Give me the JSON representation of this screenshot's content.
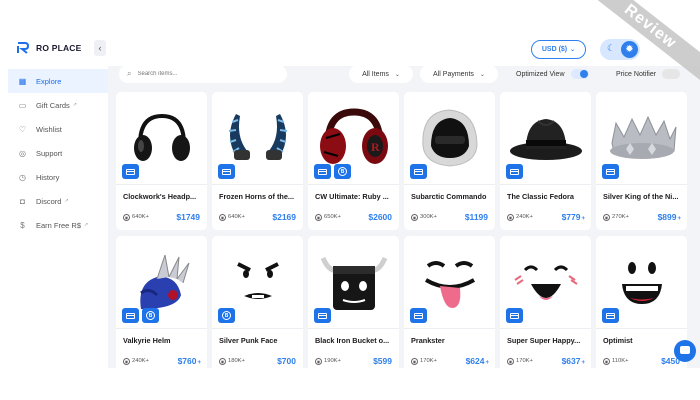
{
  "brand": {
    "name": "RO PLACE",
    "accent": "#2f80ed"
  },
  "sidebar": {
    "collapse_icon": "chevron-left-icon",
    "items": [
      {
        "label": "Explore",
        "icon": "grid-icon",
        "active": true,
        "external": false
      },
      {
        "label": "Gift Cards",
        "icon": "gift-card-icon",
        "active": false,
        "external": true
      },
      {
        "label": "Wishlist",
        "icon": "heart-icon",
        "active": false,
        "external": false
      },
      {
        "label": "Support",
        "icon": "support-icon",
        "active": false,
        "external": false
      },
      {
        "label": "History",
        "icon": "clock-icon",
        "active": false,
        "external": false
      },
      {
        "label": "Discord",
        "icon": "discord-icon",
        "active": false,
        "external": true
      },
      {
        "label": "Earn Free R$",
        "icon": "dollar-icon",
        "active": false,
        "external": true
      }
    ]
  },
  "topbar": {
    "currency": "USD ($)",
    "theme_moon_icon": "moon-icon",
    "theme_sun_icon": "sun-icon"
  },
  "filters": {
    "search_placeholder": "Search items...",
    "category": "All Items",
    "payments": "All Payments",
    "optimized_label": "Optimized View",
    "optimized_on": true,
    "notifier_label": "Price Notifier",
    "notifier_on": false
  },
  "ribbon": "Review",
  "items": [
    {
      "name": "Clockwork's Headp...",
      "sold": "640K+",
      "price": "$1749",
      "plus": "",
      "coin": false
    },
    {
      "name": "Frozen Horns of the...",
      "sold": "640K+",
      "price": "$2169",
      "plus": "",
      "coin": false
    },
    {
      "name": "CW Ultimate: Ruby ...",
      "sold": "650K+",
      "price": "$2600",
      "plus": "",
      "coin": true
    },
    {
      "name": "Subarctic Commando",
      "sold": "300K+",
      "price": "$1199",
      "plus": "",
      "coin": false
    },
    {
      "name": "The Classic Fedora",
      "sold": "240K+",
      "price": "$779",
      "plus": "+",
      "coin": false
    },
    {
      "name": "Silver King of the Ni...",
      "sold": "270K+",
      "price": "$899",
      "plus": "+",
      "coin": false
    },
    {
      "name": "Valkyrie Helm",
      "sold": "240K+",
      "price": "$760",
      "plus": "+",
      "coin": true
    },
    {
      "name": "Silver Punk Face",
      "sold": "180K+",
      "price": "$700",
      "plus": "",
      "coin": true
    },
    {
      "name": "Black Iron Bucket o...",
      "sold": "190K+",
      "price": "$599",
      "plus": "",
      "coin": false
    },
    {
      "name": "Prankster",
      "sold": "170K+",
      "price": "$624",
      "plus": "+",
      "coin": false
    },
    {
      "name": "Super Super Happy...",
      "sold": "170K+",
      "price": "$637",
      "plus": "+",
      "coin": false
    },
    {
      "name": "Optimist",
      "sold": "110K+",
      "price": "$450",
      "plus": "",
      "coin": false
    }
  ]
}
